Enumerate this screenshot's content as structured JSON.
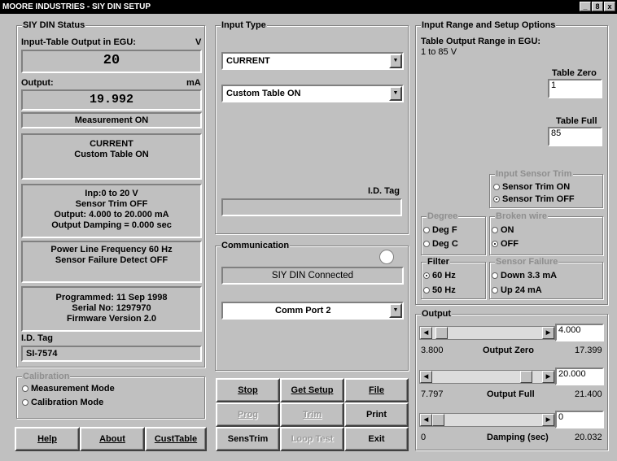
{
  "window": {
    "title": "MOORE INDUSTRIES - SIY DIN SETUP",
    "controls": [
      "_",
      "8",
      "x"
    ]
  },
  "status": {
    "group_title": "SIY DIN Status",
    "input_label": "Input-Table Output in EGU:",
    "input_unit": "V",
    "input_value": "20",
    "output_label": "Output:",
    "output_unit": "mA",
    "output_value": "19.992",
    "measurement": "Measurement ON",
    "type_line1": "CURRENT",
    "type_line2": "Custom Table ON",
    "range_line1": "Inp:0 to 20 V",
    "range_line2": "Sensor Trim OFF",
    "range_line3": "Output: 4.000 to 20.000 mA",
    "range_line4": "Output Damping = 0.000 sec",
    "power_line1": "Power Line Frequency 60 Hz",
    "power_line2": "Sensor Failure Detect OFF",
    "prog_line1": "Programmed: 11 Sep 1998",
    "prog_line2": "Serial No: 1297970",
    "prog_line3": "Firmware Version 2.0",
    "id_label": "I.D. Tag",
    "id_value": "SI-7574"
  },
  "calibration": {
    "title": "Calibration",
    "opt1": "Measurement Mode",
    "opt2": "Calibration Mode"
  },
  "bottom_buttons": {
    "help": "Help",
    "about": "About",
    "custtable": "CustTable"
  },
  "input_type": {
    "title": "Input Type",
    "combo1": "CURRENT",
    "combo2": "Custom Table ON",
    "id_label": "I.D. Tag",
    "id_value": ""
  },
  "communication": {
    "title": "Communication",
    "status": "SIY DIN Connected",
    "port": "Comm Port 2"
  },
  "actions": {
    "stop": "Stop",
    "get_setup": "Get Setup",
    "file": "File",
    "prog": "Prog",
    "trim": "Trim",
    "print": "Print",
    "senstrim": "SensTrim",
    "loop_test": "Loop Test",
    "exit": "Exit"
  },
  "range": {
    "title": "Input Range and Setup Options",
    "table_label": "Table Output Range in EGU:",
    "table_range": "1 to 85 V",
    "zero_label": "Table Zero",
    "zero_value": "1",
    "full_label": "Table Full",
    "full_value": "85",
    "trim_title": "Input Sensor Trim",
    "trim_on": "Sensor Trim ON",
    "trim_off": "Sensor Trim OFF",
    "degree_title": "Degree",
    "deg_f": "Deg F",
    "deg_c": "Deg C",
    "broken_title": "Broken wire",
    "broken_on": "ON",
    "broken_off": "OFF",
    "filter_title": "Filter",
    "f60": "60 Hz",
    "f50": "50 Hz",
    "failure_title": "Sensor Failure",
    "down": "Down 3.3 mA",
    "up": "Up 24 mA"
  },
  "output": {
    "title": "Output",
    "zero_value": "4.000",
    "zero_min": "3.800",
    "zero_label": "Output Zero",
    "zero_max": "17.399",
    "zero_pos": 0.03,
    "full_value": "20.000",
    "full_min": "7.797",
    "full_label": "Output Full",
    "full_max": "21.400",
    "full_pos": 0.9,
    "damp_value": "0",
    "damp_min": "0",
    "damp_label": "Damping (sec)",
    "damp_max": "20.032",
    "damp_pos": 0.0
  }
}
